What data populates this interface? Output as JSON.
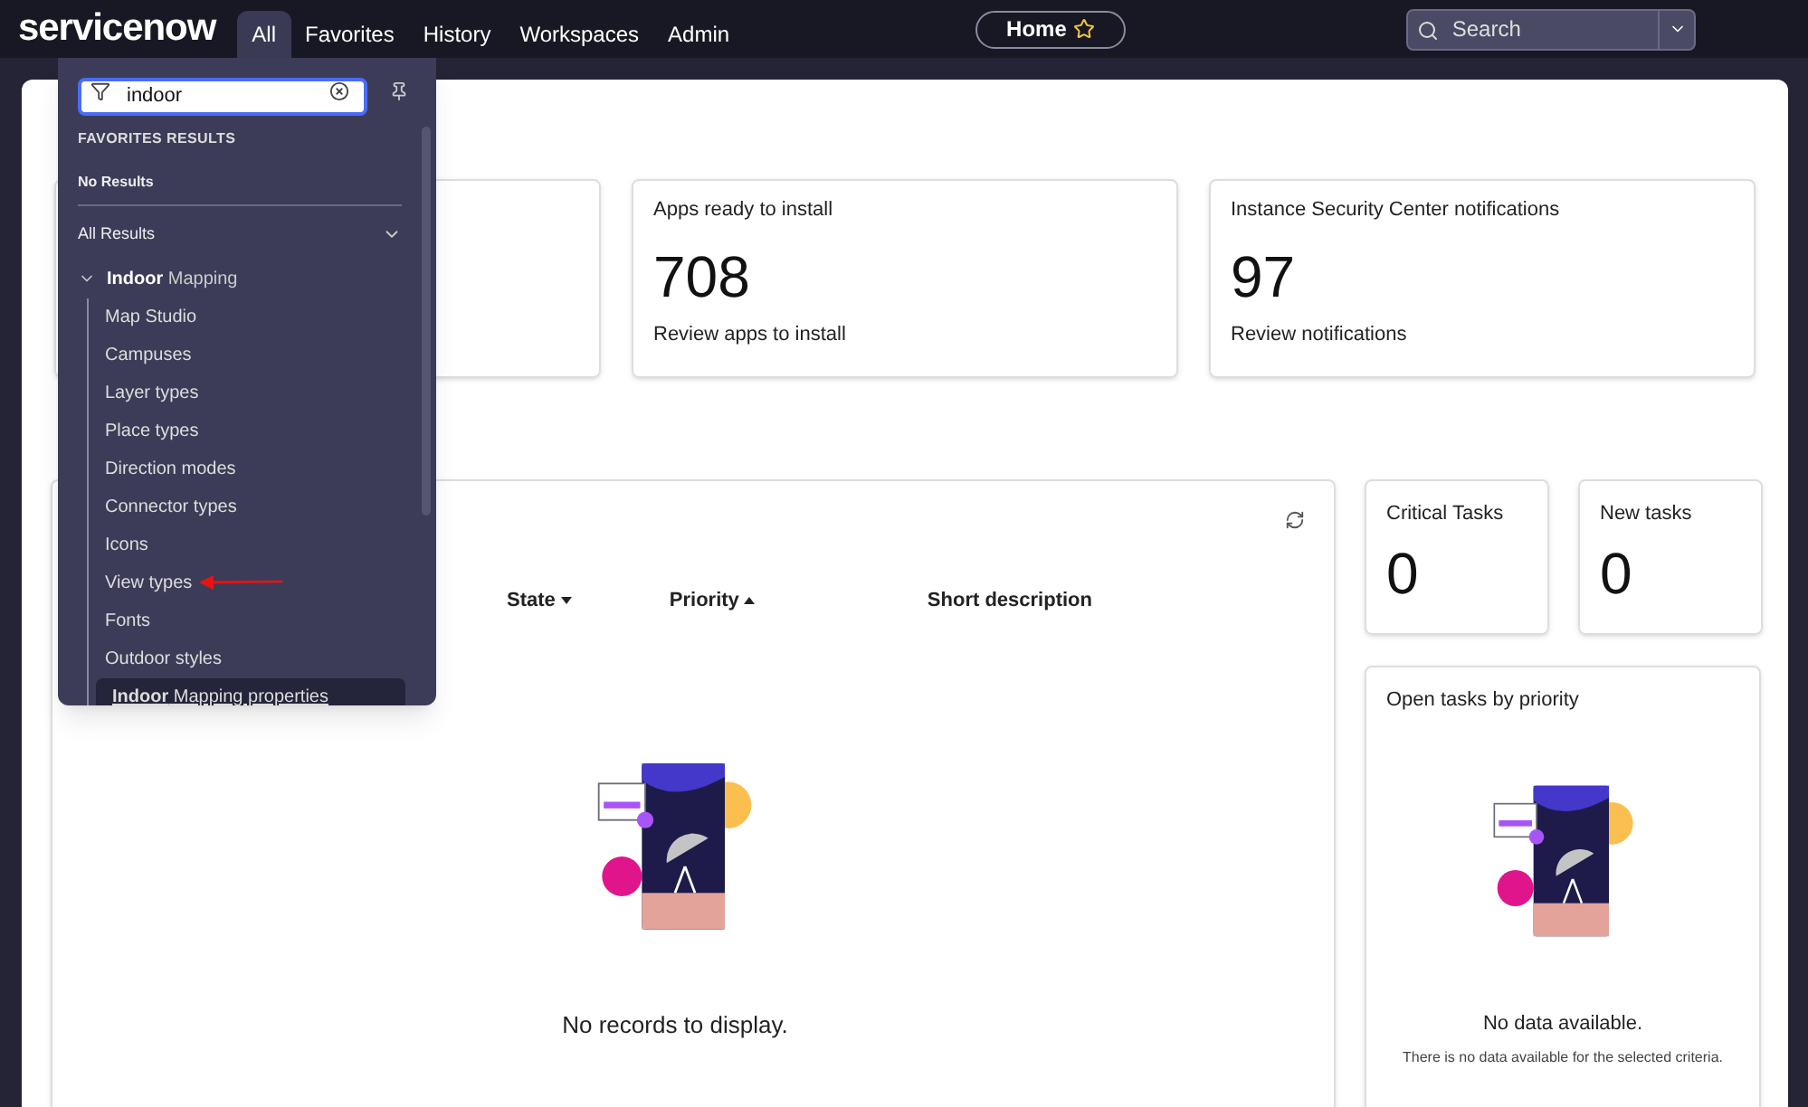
{
  "nav": {
    "logo": "servicenow",
    "tabs": [
      {
        "label": "All",
        "selected": true
      },
      {
        "label": "Favorites",
        "selected": false
      },
      {
        "label": "History",
        "selected": false
      },
      {
        "label": "Workspaces",
        "selected": false
      },
      {
        "label": "Admin",
        "selected": false
      }
    ],
    "home": "Home",
    "search": {
      "placeholder": "Search"
    }
  },
  "menu": {
    "filter": "indoor",
    "favorites_heading": "FAVORITES RESULTS",
    "favorites_empty": "No Results",
    "all_results": "All Results",
    "group": {
      "label": "**Indoor** Mapping",
      "expanded": true,
      "children": [
        {
          "label": "Map Studio",
          "selected": false
        },
        {
          "label": "Campuses",
          "selected": false
        },
        {
          "label": "Layer types",
          "selected": false
        },
        {
          "label": "Place types",
          "selected": false
        },
        {
          "label": "Direction modes",
          "selected": false
        },
        {
          "label": "Connector types",
          "selected": false
        },
        {
          "label": "Icons",
          "selected": false
        },
        {
          "label": "View types",
          "selected": false,
          "annotated": true
        },
        {
          "label": "Fonts",
          "selected": false
        },
        {
          "label": "Outdoor styles",
          "selected": false
        },
        {
          "label": "**Indoor** Mapping properties",
          "selected": true
        }
      ]
    }
  },
  "cards": [
    {
      "kind": "covered"
    },
    {
      "kind": "stat",
      "title": "Apps ready to install",
      "value": "708",
      "link": "Review apps to install"
    },
    {
      "kind": "stat",
      "title": "Instance Security Center notifications",
      "value": "97",
      "link": "Review notifications"
    }
  ],
  "work": {
    "columns": [
      {
        "label": "State",
        "kind": "descending"
      },
      {
        "label": "Priority",
        "kind": "ascending"
      },
      {
        "label": "Short description",
        "kind": "plain"
      }
    ],
    "empty": "No records to display."
  },
  "tiles": [
    {
      "title": "Critical Tasks",
      "value": "0"
    },
    {
      "title": "New tasks",
      "value": "0"
    }
  ],
  "priority_card": {
    "title": "Open tasks by priority",
    "empty_title": "No data available.",
    "empty_text": "There is no data available for the selected criteria."
  }
}
